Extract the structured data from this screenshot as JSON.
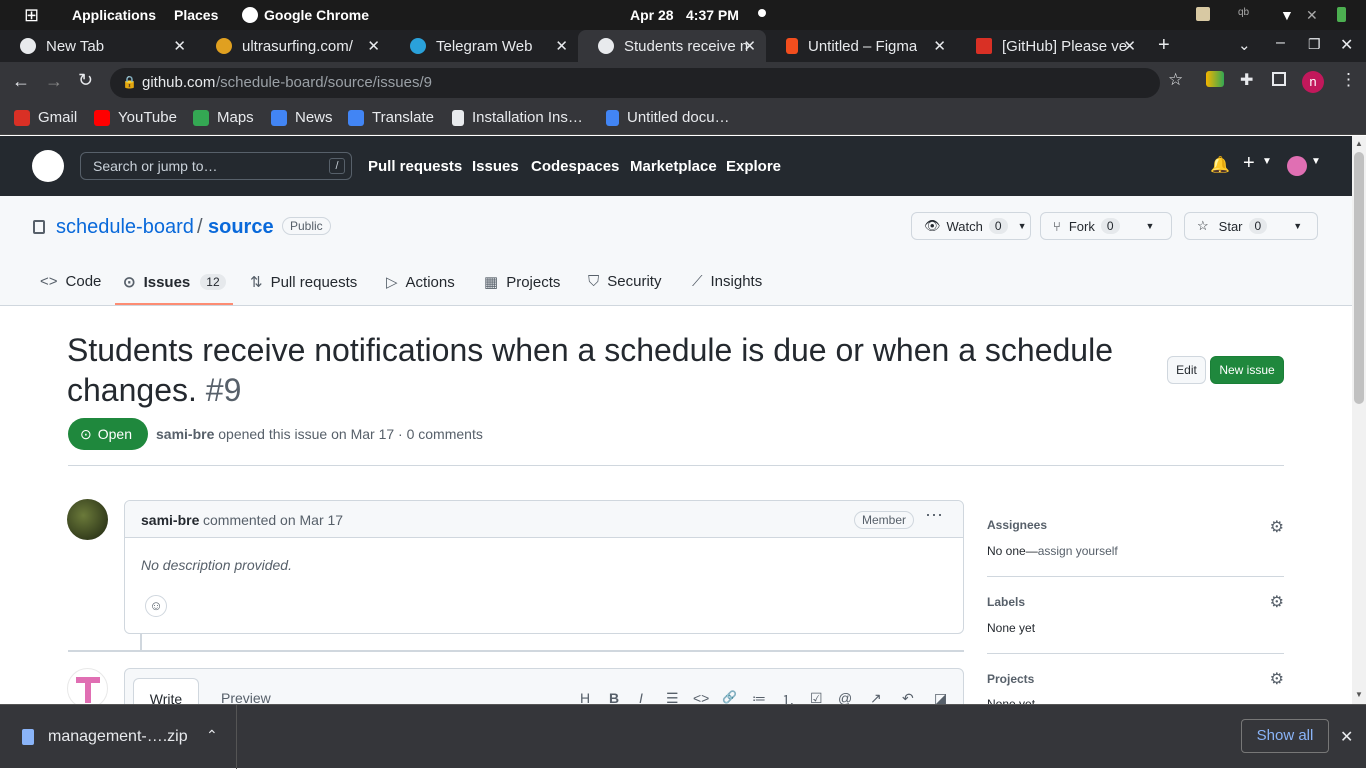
{
  "topbar": {
    "applications": "Applications",
    "places": "Places",
    "app_name": "Google Chrome",
    "date": "Apr 28",
    "time": "4:37 PM"
  },
  "tabs": [
    {
      "title": "New Tab",
      "fav": "#4285f4"
    },
    {
      "title": "ultrasurfing.com/",
      "fav": "#e0a020"
    },
    {
      "title": "Telegram Web",
      "fav": "#2aa1da"
    },
    {
      "title": "Students receive no",
      "fav": "#ffffff"
    },
    {
      "title": "Untitled – Figma",
      "fav": "#f24e1e"
    },
    {
      "title": "[GitHub] Please ve",
      "fav": "#d93025"
    }
  ],
  "address": {
    "host": "github.com",
    "path": "/schedule-board/source/issues/9",
    "profile": "n"
  },
  "bookmarks": [
    {
      "label": "Gmail",
      "color": "#d93025"
    },
    {
      "label": "YouTube",
      "color": "#ff0000"
    },
    {
      "label": "Maps",
      "color": "#34a853"
    },
    {
      "label": "News",
      "color": "#4285f4"
    },
    {
      "label": "Translate",
      "color": "#4285f4"
    },
    {
      "label": "Installation Ins…",
      "color": "#e8eaed"
    },
    {
      "label": "Untitled docu…",
      "color": "#4285f4"
    }
  ],
  "github": {
    "search_placeholder": "Search or jump to…",
    "search_key": "/",
    "nav": [
      "Pull requests",
      "Issues",
      "Codespaces",
      "Marketplace",
      "Explore"
    ]
  },
  "repo": {
    "owner": "schedule-board",
    "sep": "/",
    "name": "source",
    "visibility": "Public",
    "watch_label": "Watch",
    "watch_count": "0",
    "fork_label": "Fork",
    "fork_count": "0",
    "star_label": "Star",
    "star_count": "0",
    "tabs": [
      {
        "label": "Code",
        "icon": "<>"
      },
      {
        "label": "Issues",
        "icon": "⊙",
        "count": "12"
      },
      {
        "label": "Pull requests",
        "icon": "⇅"
      },
      {
        "label": "Actions",
        "icon": "▷"
      },
      {
        "label": "Projects",
        "icon": "▦"
      },
      {
        "label": "Security",
        "icon": "⛉"
      },
      {
        "label": "Insights",
        "icon": "⟋"
      }
    ]
  },
  "issue": {
    "title": "Students receive notifications when a schedule is due or when a schedule changes.",
    "number": "#9",
    "edit_label": "Edit",
    "new_issue_label": "New issue",
    "state": "Open",
    "author": "sami-bre",
    "meta_text": "opened this issue on Mar 17 · 0 comments"
  },
  "comment": {
    "author": "sami-bre",
    "meta": "commented on Mar 17",
    "badge": "Member",
    "body": "No description provided."
  },
  "sidebar": {
    "assignees_title": "Assignees",
    "assignees_value": "No one—",
    "assign_yourself": "assign yourself",
    "labels_title": "Labels",
    "labels_value": "None yet",
    "projects_title": "Projects",
    "projects_value": "None yet"
  },
  "editor": {
    "write_tab": "Write",
    "preview_tab": "Preview",
    "tools": [
      "H",
      "B",
      "I",
      "☰",
      "<>",
      "🔗",
      "≔",
      "⒈",
      "☑",
      "@",
      "↗",
      "↶",
      "◪"
    ]
  },
  "download": {
    "file": "management-….zip",
    "show_all": "Show all"
  }
}
